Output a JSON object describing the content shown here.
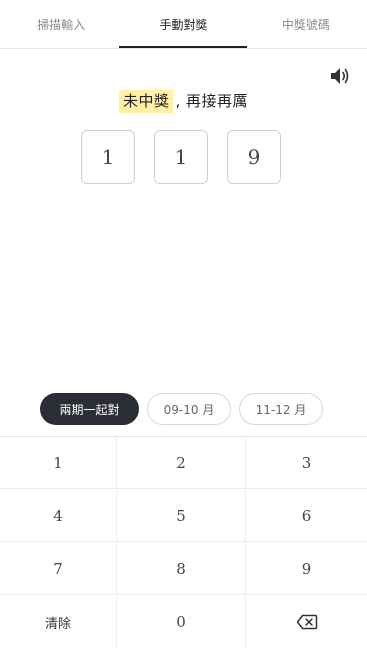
{
  "tabs": {
    "scan_label": "掃描輸入",
    "manual_label": "手動對獎",
    "numbers_label": "中獎號碼",
    "active": "manual"
  },
  "sound_icon": "speaker-icon",
  "result": {
    "status_label": "未中獎",
    "message": ", 再接再厲"
  },
  "digits": [
    "1",
    "1",
    "9"
  ],
  "periods": {
    "both_label": "兩期一起對",
    "first_label": "09-10 月",
    "second_label": "11-12 月",
    "selected": "both"
  },
  "keypad": {
    "keys": [
      "1",
      "2",
      "3",
      "4",
      "5",
      "6",
      "7",
      "8",
      "9"
    ],
    "clear_label": "清除",
    "zero_label": "0",
    "backspace_icon": "backspace-icon"
  },
  "colors": {
    "highlight": "#fff0a3",
    "chip_active_bg": "#2a2d33",
    "tab_active": "#222222"
  }
}
